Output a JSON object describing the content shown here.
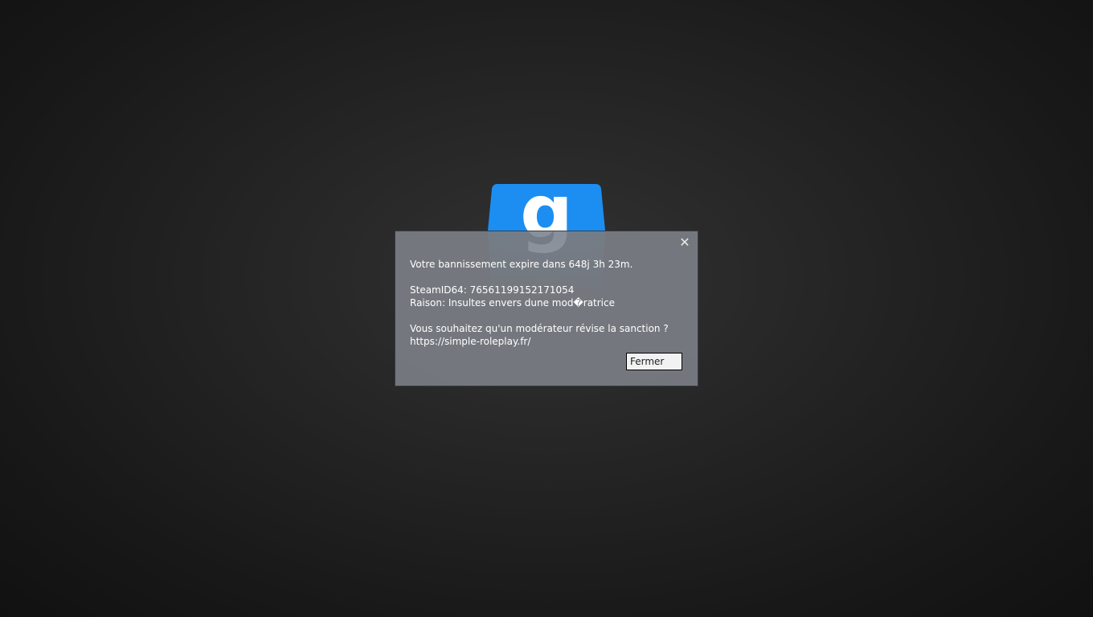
{
  "dialog": {
    "close_glyph": "✕",
    "lines": {
      "expiry": "Votre bannissement expire dans 648j 3h 23m.",
      "steamid": "SteamID64: 76561199152171054",
      "reason": "Raison: Insultes envers dune mod�ratrice",
      "appeal": "Vous souhaitez qu'un modérateur révise la sanction ?",
      "url": "https://simple-roleplay.fr/"
    },
    "button_label": "Fermer"
  },
  "logo": {
    "icon": "garrys-mod-logo",
    "letter": "g",
    "color": "#1c8ef2"
  },
  "colors": {
    "dialog_bg": "#80858c",
    "text": "#ffffff"
  }
}
